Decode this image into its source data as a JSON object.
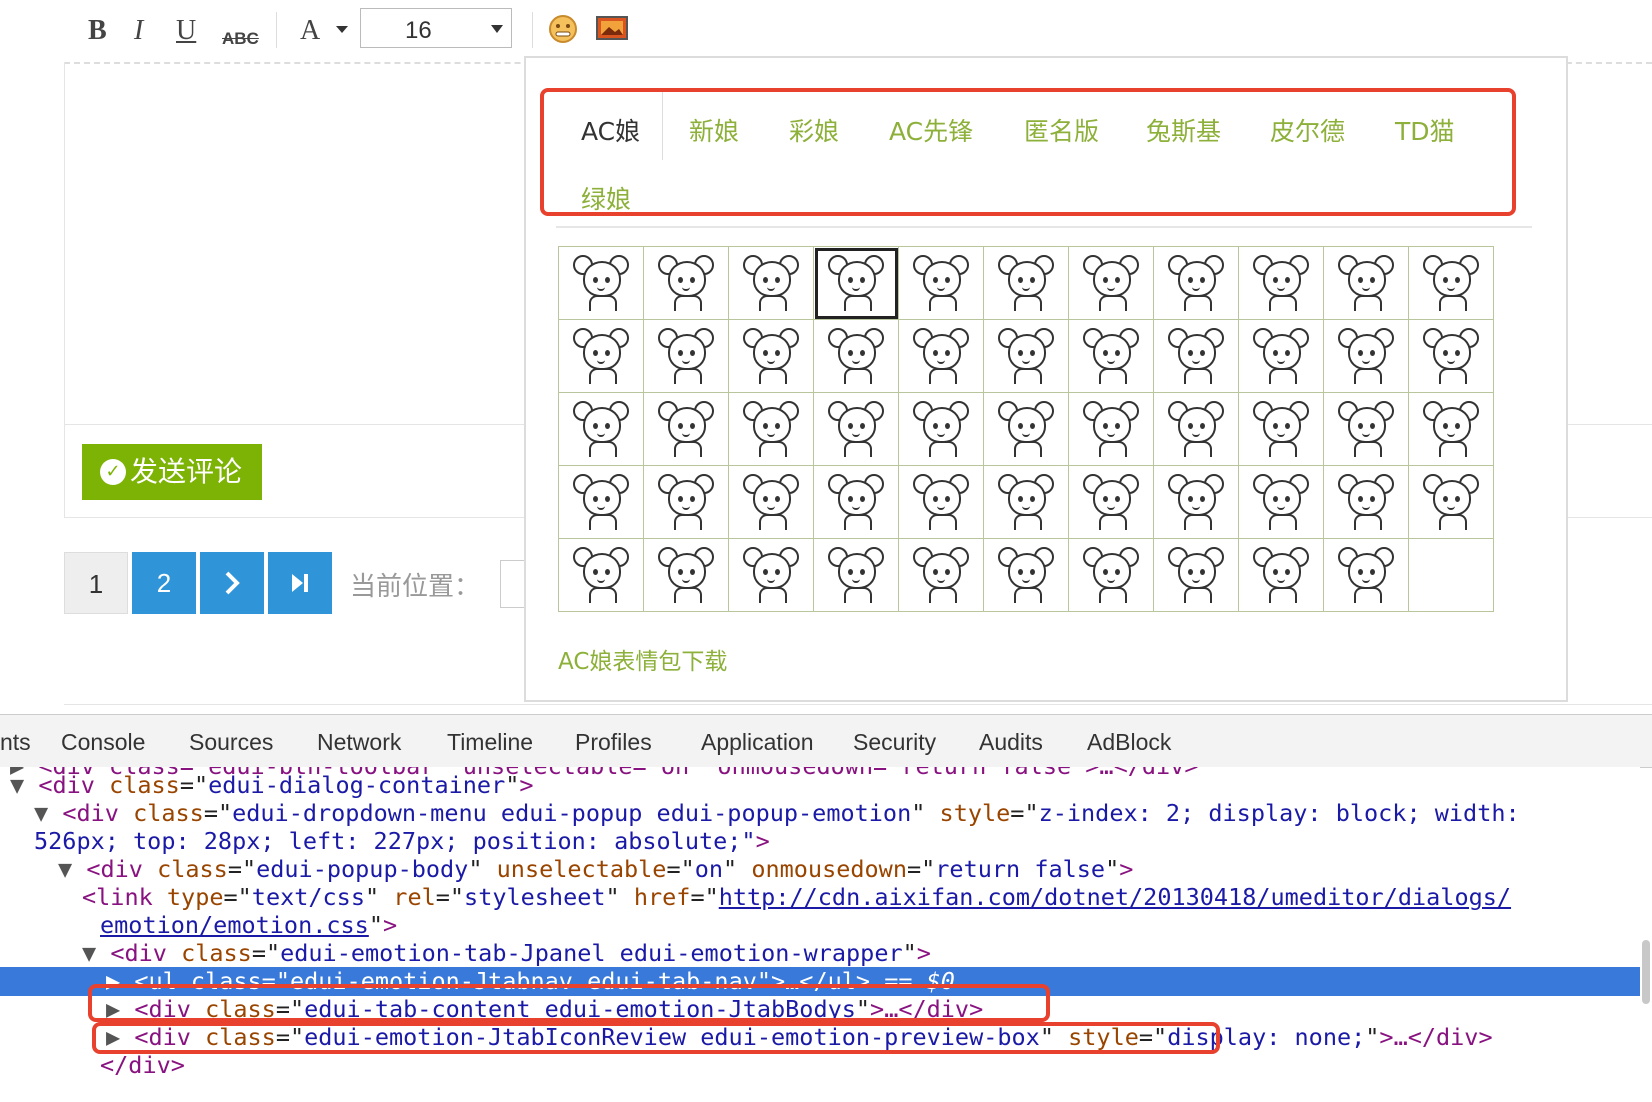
{
  "toolbar": {
    "bold": "B",
    "italic": "I",
    "underline": "U",
    "strike": "ABC",
    "font_color": "A",
    "font_size_value": "16"
  },
  "send_button": {
    "label": "发送评论"
  },
  "pager": {
    "pages": [
      "1",
      "2"
    ],
    "next": "›",
    "last": "⏭",
    "current_position_label": "当前位置："
  },
  "emotion_popup": {
    "tabs": [
      "AC娘",
      "新娘",
      "彩娘",
      "AC先锋",
      "匿名版",
      "兔斯基",
      "皮尔德",
      "TD猫",
      "绿娘"
    ],
    "active_tab": "AC娘",
    "download_link": "AC娘表情包下载",
    "emoji_count": 54,
    "grid_columns": 11,
    "selected_index": 3,
    "accent_color": "#8db03a",
    "highlight_color": "#e8412e"
  },
  "devtools": {
    "tabs": [
      "nts",
      "Console",
      "Sources",
      "Network",
      "Timeline",
      "Profiles",
      "Application",
      "Security",
      "Audits",
      "AdBlock"
    ],
    "lines": [
      {
        "indent": 0,
        "tri": "▶",
        "raw": "<div class=\"edui-btn-toolbar\" unselectable=\"on\" onmousedown=\"return false\">…</div>"
      },
      {
        "indent": 0,
        "tri": "▼",
        "tag_open": "<div",
        "attr": "class",
        "value": "edui-dialog-container",
        "tag_close": ">"
      },
      {
        "indent": 1,
        "tri": "▼",
        "tag_open": "<div",
        "attr": "class",
        "value": "edui-dropdown-menu edui-popup edui-popup-emotion",
        "attr2": "style",
        "value2": "z-index: 2; display: block; width:"
      },
      {
        "indent": 0,
        "tri": "",
        "continuation": "526px; top: 28px; left: 227px; position: absolute;",
        "tag_close": ">"
      },
      {
        "indent": 2,
        "tri": "▼",
        "tag_open": "<div",
        "attr": "class",
        "value": "edui-popup-body",
        "attr2": "unselectable",
        "value2": "on",
        "attr3": "onmousedown",
        "value3": "return false",
        "tag_close": ">"
      },
      {
        "indent": 3,
        "tri": "",
        "tag_open": "<link",
        "attr": "type",
        "value": "text/css",
        "attr2": "rel",
        "value2": "stylesheet",
        "attr3": "href",
        "href": "http://cdn.aixifan.com/dotnet/20130418/umeditor/dialogs/"
      },
      {
        "indent": 3,
        "tri": "",
        "href_cont": "emotion/emotion.css",
        "tag_close": ">"
      },
      {
        "indent": 3,
        "tri": "▼",
        "tag_open": "<div",
        "attr": "class",
        "value": "edui-emotion-tab-Jpanel edui-emotion-wrapper",
        "tag_close": ">"
      },
      {
        "indent": 4,
        "tri": "▶",
        "tag_open": "<ul",
        "attr": "class",
        "value": "edui-emotion-Jtabnav edui-tab-nav",
        "tag_close": ">…</ul>",
        "suffix": " == $0",
        "selected": true
      },
      {
        "indent": 4,
        "tri": "▶",
        "tag_open": "<div",
        "attr": "class",
        "value": "edui-tab-content edui-emotion-JtabBodys",
        "tag_close": ">…</div>"
      },
      {
        "indent": 4,
        "tri": "▶",
        "tag_open": "<div",
        "attr": "class",
        "value": "edui-emotion-JtabIconReview edui-emotion-preview-box",
        "attr2": "style",
        "value2": "display: none;",
        "tag_close": ">…</div>"
      },
      {
        "indent": 3,
        "tri": "",
        "raw_close": "</div>"
      }
    ]
  }
}
